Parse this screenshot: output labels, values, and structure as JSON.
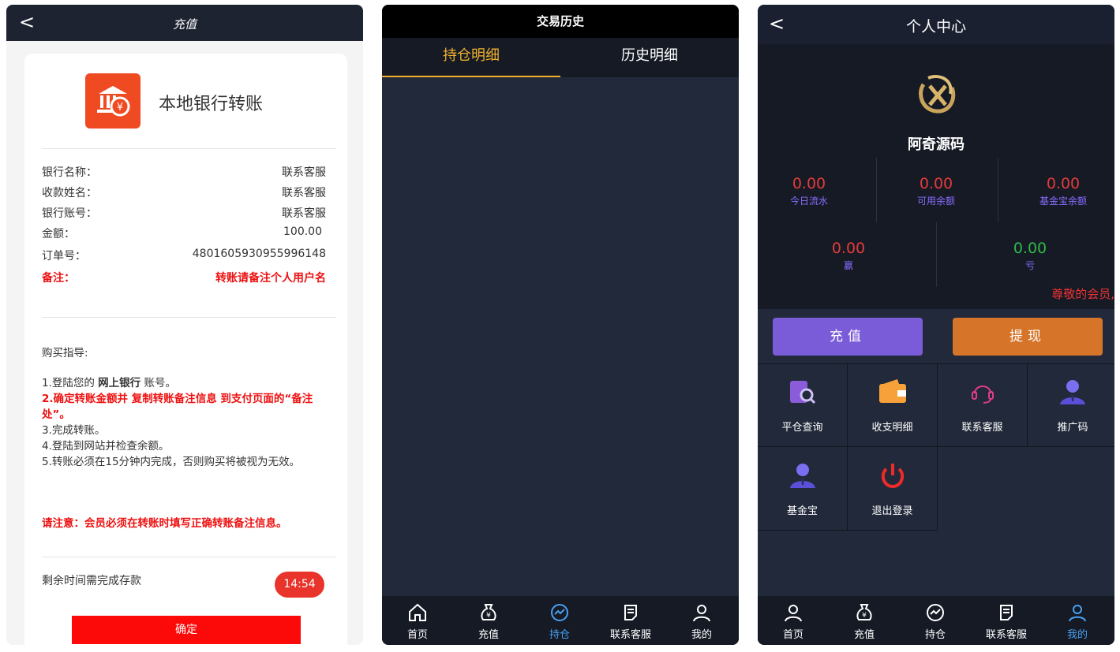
{
  "recharge_panel": {
    "header": {
      "back": "<",
      "title": "充值"
    },
    "bank_title": "本地银行转账",
    "fields": [
      {
        "label": "银行名称：",
        "value": "联系客服"
      },
      {
        "label": "收款姓名：",
        "value": "联系客服"
      },
      {
        "label": "银行账号：",
        "value": "联系客服"
      },
      {
        "label": "金额：",
        "value": "100.00"
      },
      {
        "label": "订单号：",
        "value": "4801605930955996148"
      },
      {
        "label": "备注：",
        "value": "转账请备注个人用户名"
      }
    ],
    "guide_title": "购买指导:",
    "guide": {
      "s1_a": "1.登陆您的 ",
      "s1_b": "网上银行",
      "s1_c": " 账号。",
      "s2": "2.确定转账金额并 复制转账备注信息 到支付页面的“备注处”。",
      "s3": "3.完成转账。",
      "s4": "4.登陆到网站并检查余额。",
      "s5": "5.转账必须在15分钟内完成，否则购买将被视为无效。",
      "notice": "请注意：会员必须在转账时填写正确转账备注信息。"
    },
    "timer_label": "剩余时间需完成存款",
    "timer_value": "14:54",
    "confirm_label": "确定"
  },
  "history_panel": {
    "title": "交易历史",
    "tabs": [
      "持仓明细",
      "历史明细"
    ],
    "tabbar": [
      {
        "label": "首页",
        "icon": "home-icon"
      },
      {
        "label": "充值",
        "icon": "money-bag-icon"
      },
      {
        "label": "持仓",
        "icon": "chart-icon"
      },
      {
        "label": "联系客服",
        "icon": "document-icon"
      },
      {
        "label": "我的",
        "icon": "user-icon"
      }
    ]
  },
  "profile_panel": {
    "header": {
      "back": "<",
      "title": "个人中心"
    },
    "username": "阿奇源码",
    "stats": [
      {
        "value": "0.00",
        "label": "今日流水"
      },
      {
        "value": "0.00",
        "label": "可用余额"
      },
      {
        "value": "0.00",
        "label": "基金宝余额"
      }
    ],
    "pnl": [
      {
        "value": "0.00",
        "label": "赢"
      },
      {
        "value": "0.00",
        "label": "亏"
      }
    ],
    "marquee": "尊敬的会员,",
    "recharge_btn": "充值",
    "withdraw_btn": "提现",
    "grid": [
      {
        "label": "平仓查询",
        "icon": "search-doc-icon"
      },
      {
        "label": "收支明细",
        "icon": "wallet-icon"
      },
      {
        "label": "联系客服",
        "icon": "headset-icon"
      },
      {
        "label": "推广码",
        "icon": "agent-icon"
      },
      {
        "label": "基金宝",
        "icon": "agent-icon"
      },
      {
        "label": "退出登录",
        "icon": "power-icon"
      }
    ],
    "tabbar": [
      {
        "label": "首页",
        "icon": "user-icon"
      },
      {
        "label": "充值",
        "icon": "money-bag-icon"
      },
      {
        "label": "持仓",
        "icon": "chart-icon"
      },
      {
        "label": "联系客服",
        "icon": "document-icon"
      },
      {
        "label": "我的",
        "icon": "user-icon"
      }
    ],
    "colors": {
      "positive": "#e53b3b",
      "negative": "#2fb84a",
      "accent": "#8a6cff"
    }
  }
}
